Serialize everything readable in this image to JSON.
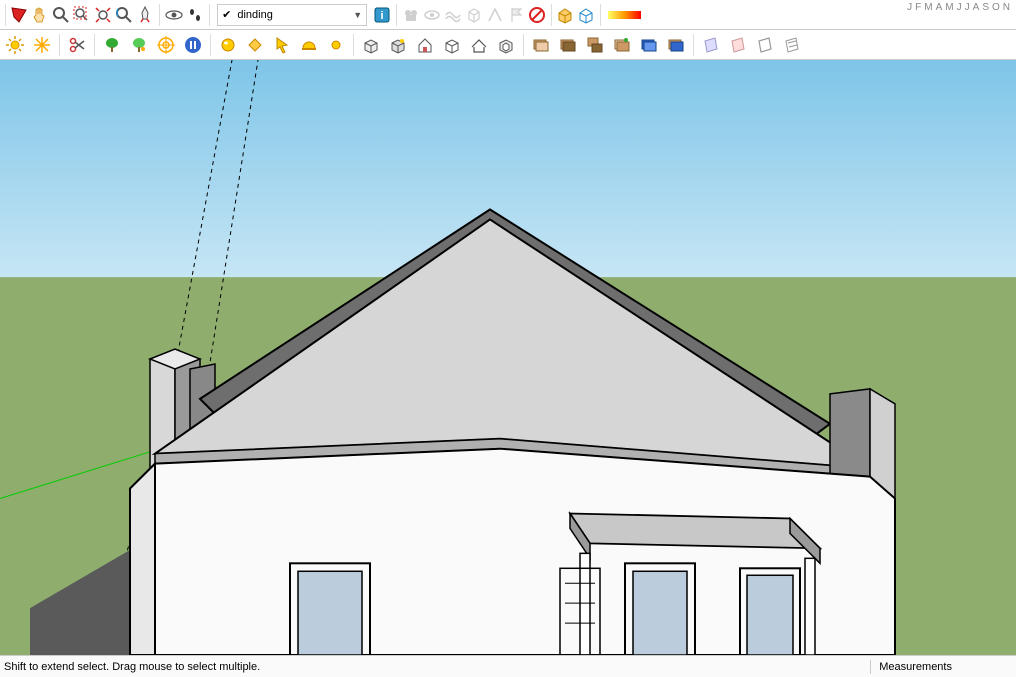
{
  "layer": {
    "selected": "dinding"
  },
  "status": {
    "hint": "Shift to extend select. Drag mouse to select multiple.",
    "measurements_label": "Measurements"
  },
  "months": [
    "J",
    "F",
    "M",
    "A",
    "M",
    "J",
    "J",
    "A",
    "S",
    "O",
    "N"
  ],
  "icons": {
    "row1": [
      "kite",
      "hand",
      "zoom",
      "zoom-window",
      "zoom-extents",
      "zoom-lens",
      "rocket",
      "eye",
      "footprints",
      "layers-info",
      "shadow-people",
      "shadow-eye",
      "shadow-wave",
      "shadow-cube",
      "shadow-edge",
      "shadow-flag",
      "block-icon",
      "style-box",
      "style-cube"
    ],
    "row2": [
      "sun",
      "star-burst",
      "scissors",
      "tree-1",
      "tree-2",
      "target",
      "pause",
      "sphere",
      "diamond",
      "pointer",
      "helmet",
      "dot",
      "box-1",
      "box-2",
      "house",
      "box-open",
      "roof",
      "roof-open",
      "layer-1",
      "layer-2",
      "layer-3",
      "layer-4",
      "layer-5",
      "layer-6",
      "sheet-1",
      "sheet-2",
      "sheet-3",
      "sheet-4"
    ]
  }
}
